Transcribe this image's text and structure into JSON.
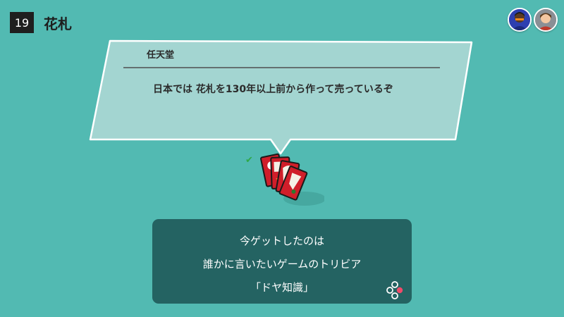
{
  "header": {
    "number": "19",
    "title": "花札"
  },
  "avatars": [
    {
      "name": "player-avatar-1",
      "color": "#2d3fb0"
    },
    {
      "name": "player-avatar-2",
      "color": "#8a8f95"
    }
  ],
  "speech_bubble": {
    "speaker": "任天堂",
    "text": "日本では 花札を130年以上前から作って売っているぞ"
  },
  "dialog": {
    "lines": [
      "今ゲットしたのは",
      "誰かに言いたいゲームのトリビア",
      "「ドヤ知識」"
    ],
    "icon": "controller-buttons-icon"
  },
  "colors": {
    "background": "#52bab2",
    "bubble": "#a3d5d1",
    "dialog": "#246362",
    "check": "#2fa848",
    "card_red": "#d01e2a"
  }
}
